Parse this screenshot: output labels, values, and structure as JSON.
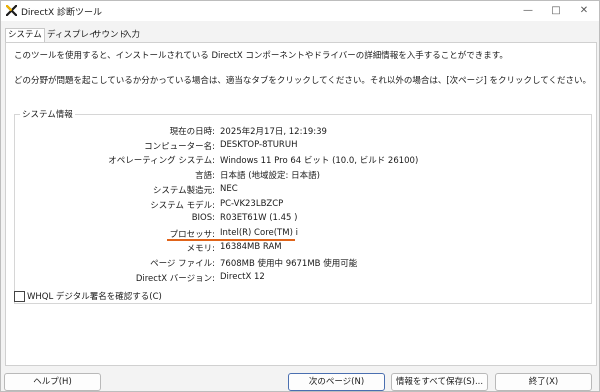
{
  "window": {
    "title": "DirectX 診断ツール",
    "minimize": "—",
    "maximize": "□",
    "close": "✕"
  },
  "tabs": [
    "システム",
    "ディスプレイ",
    "サウンド",
    "入力"
  ],
  "intro": {
    "line1": "このツールを使用すると、インストールされている DirectX コンポーネントやドライバーの詳細情報を入手することができます。",
    "line2": "どの分野が問題を起こしているか分かっている場合は、適当なタブをクリックしてください。それ以外の場合は、[次ページ] をクリックしてください。"
  },
  "system_info": {
    "group_title": "システム情報",
    "rows": [
      {
        "label": "現在の日時:",
        "value": "2025年2月17日, 12:19:39"
      },
      {
        "label": "コンピューター名:",
        "value": "DESKTOP-8TURUH"
      },
      {
        "label": "オペレーティング システム:",
        "value": "Windows 11 Pro 64 ビット (10.0, ビルド 26100)"
      },
      {
        "label": "言語:",
        "value": "日本語 (地域設定: 日本語)"
      },
      {
        "label": "システム製造元:",
        "value": "NEC"
      },
      {
        "label": "システム モデル:",
        "value": "PC-VK23LBZCP"
      },
      {
        "label": "BIOS:",
        "value": "R03ET61W (1.45 )"
      },
      {
        "label": "プロセッサ:",
        "value": "Intel(R) Core(TM) i"
      },
      {
        "label": "メモリ:",
        "value": "16384MB RAM"
      },
      {
        "label": "ページ ファイル:",
        "value": "7608MB 使用中 9671MB 使用可能"
      },
      {
        "label": "DirectX バージョン:",
        "value": "DirectX 12"
      }
    ]
  },
  "checkbox": {
    "label": "WHQL デジタル署名を確認する(C)",
    "checked": false
  },
  "buttons": {
    "help": "ヘルプ(H)",
    "next": "次のページ(N)",
    "save_all": "情報をすべて保存(S)...",
    "exit": "終了(X)"
  },
  "colors": {
    "highlight_underline": "#e0641a",
    "default_button_border": "#4a6fb0"
  }
}
